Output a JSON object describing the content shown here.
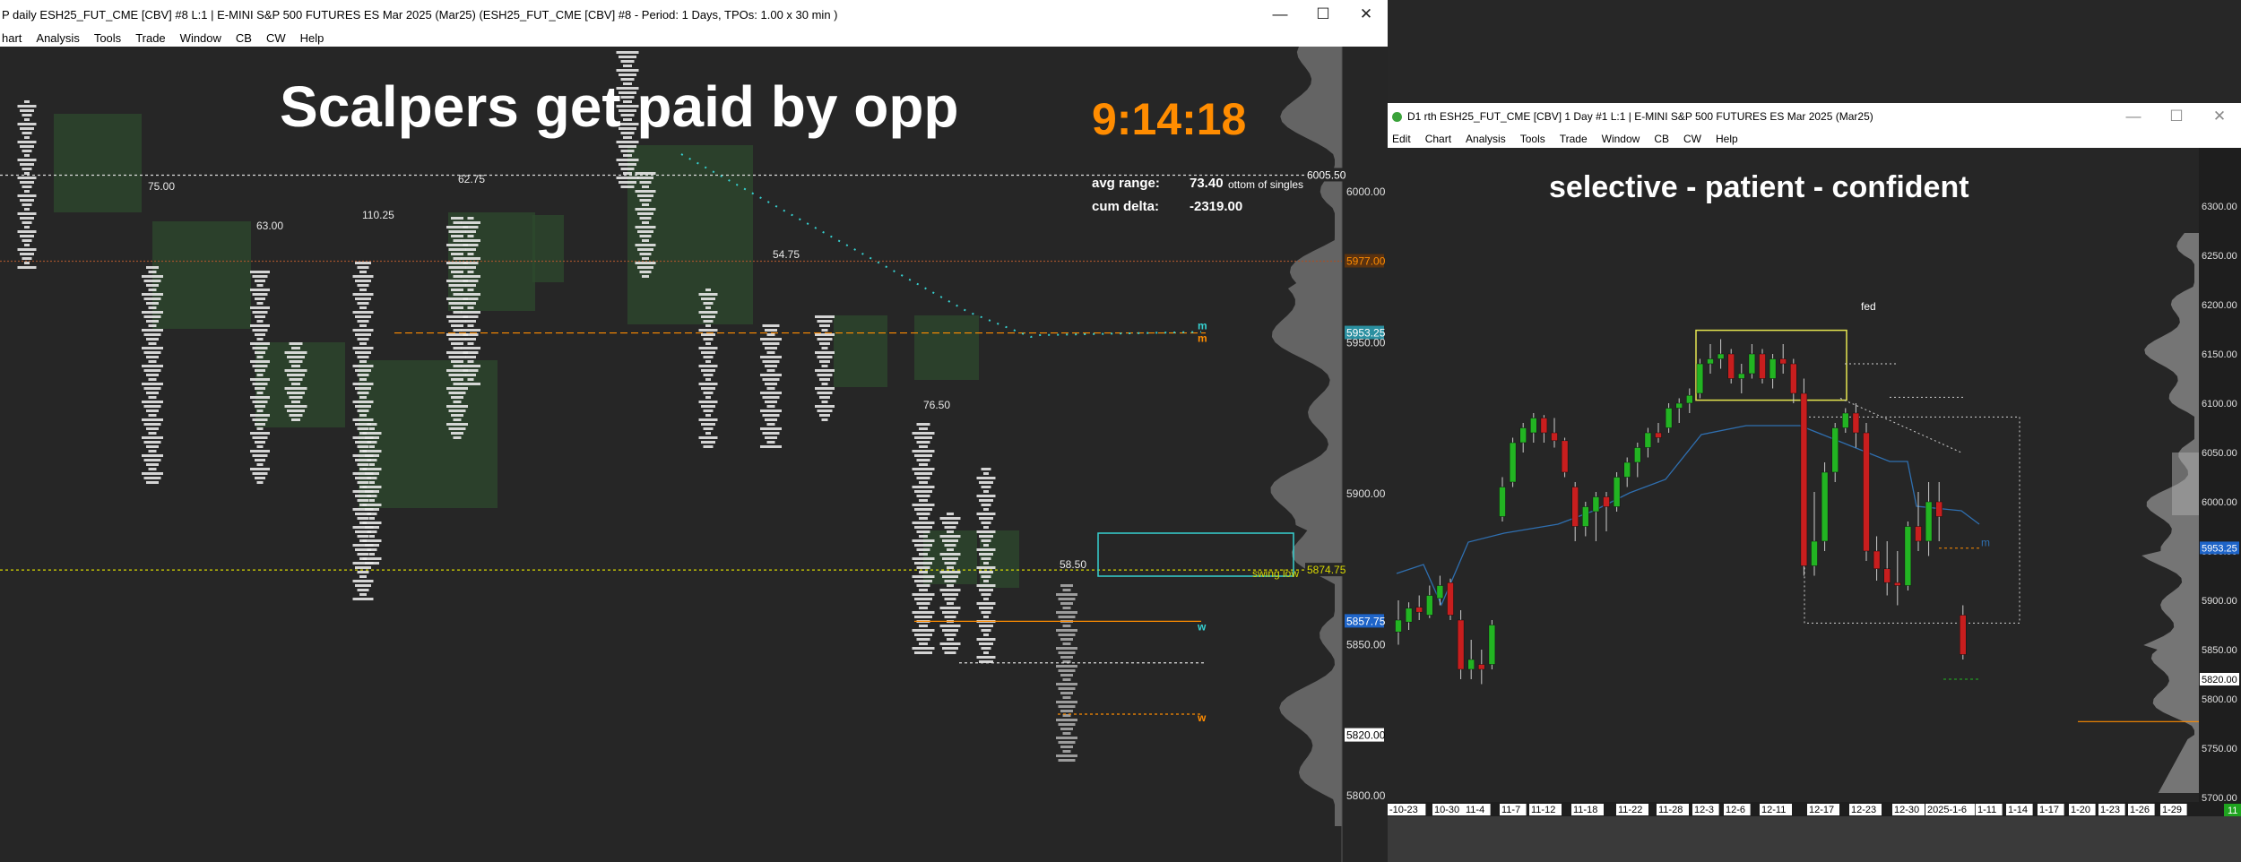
{
  "left_window": {
    "title": "P daily ESH25_FUT_CME [CBV] #8 L:1 | E-MINI S&P 500 FUTURES ES Mar 2025 (Mar25) (ESH25_FUT_CME [CBV] #8 - Period: 1 Days, TPOs: 1.00 x 30 min )",
    "menu": [
      "hart",
      "Analysis",
      "Tools",
      "Trade",
      "Window",
      "CB",
      "CW",
      "Help"
    ],
    "headline": "Scalpers get paid by opp",
    "clock": "9:14:18",
    "stats": {
      "avg_range_label": "avg range:",
      "avg_range_value": "73.40",
      "cum_delta_label": "cum delta:",
      "cum_delta_value": "-2319.00",
      "bottom_singles": "ottom of singles"
    },
    "range_labels": [
      "75.00",
      "63.00",
      "110.25",
      "62.75",
      "54.75",
      "76.50",
      "58.50"
    ],
    "swing_low_label": "swing low",
    "line_marks": [
      "m",
      "m",
      "w",
      "w"
    ],
    "price_axis": [
      {
        "text": "6005.50",
        "price": 6005.5,
        "style": "tag"
      },
      {
        "text": "6000.00",
        "price": 6000,
        "style": "tick"
      },
      {
        "text": "5977.00",
        "price": 5977,
        "style": "orange"
      },
      {
        "text": "5953.25",
        "price": 5953.25,
        "style": "cyan"
      },
      {
        "text": "5950.00",
        "price": 5950,
        "style": "tick"
      },
      {
        "text": "5900.00",
        "price": 5900,
        "style": "tick"
      },
      {
        "text": "5874.75",
        "price": 5874.75,
        "style": "tag"
      },
      {
        "text": "5857.75",
        "price": 5857.75,
        "style": "blue"
      },
      {
        "text": "5850.00",
        "price": 5850,
        "style": "tick"
      },
      {
        "text": "5820.00",
        "price": 5820,
        "style": "white"
      },
      {
        "text": "5800.00",
        "price": 5800,
        "style": "tick"
      }
    ]
  },
  "right_window": {
    "title": "D1 rth ESH25_FUT_CME [CBV]  1 Day  #1 L:1 | E-MINI S&P 500 FUTURES ES Mar 2025 (Mar25)",
    "menu": [
      "Edit",
      "Chart",
      "Analysis",
      "Tools",
      "Trade",
      "Window",
      "CB",
      "CW",
      "Help"
    ],
    "headline": "selective  -  patient  -  confident",
    "fed_label": "fed",
    "mark_label": "m",
    "price_ticks": [
      "6300.00",
      "6250.00",
      "6200.00",
      "6150.00",
      "6100.00",
      "6050.00",
      "6000.00",
      "5950.00",
      "5900.00",
      "5850.00",
      "5800.00",
      "5750.00",
      "5700.00"
    ],
    "price_tags": [
      {
        "text": "5953.25",
        "price": 5953.25,
        "color": "#1e64c8"
      },
      {
        "text": "5820.00",
        "price": 5820,
        "color": "#ffffff"
      }
    ],
    "date_ticks": [
      "-10-23",
      "10-30",
      "11-4",
      "11-7",
      "11-12",
      "11-18",
      "11-22",
      "11-28",
      "12-3",
      "12-6",
      "12-11",
      "12-17",
      "12-23",
      "12-30",
      "2025-1-6",
      "1-11",
      "1-14",
      "1-17",
      "1-20",
      "1-23",
      "1-26",
      "1-29"
    ],
    "corner_badge": "11"
  },
  "colors": {
    "up": "#22b422",
    "down": "#c81e1e",
    "orange": "#ff8c00",
    "cyan": "#36d0d0",
    "value_area": "#2e4a2e",
    "profile": "#707070",
    "yellow": "#e6e650"
  },
  "chart_data": [
    {
      "type": "candlestick",
      "name": "",
      "dates": [
        "10-23",
        "10-24",
        "10-25",
        "10-28",
        "10-29",
        "10-30",
        "10-31",
        "11-1",
        "11-4",
        "11-5",
        "11-6",
        "11-7",
        "11-8",
        "11-11",
        "11-12",
        "11-13",
        "11-14",
        "11-15",
        "11-18",
        "11-19",
        "11-20",
        "11-21",
        "11-22",
        "11-25",
        "11-26",
        "11-27",
        "11-29",
        "12-2",
        "12-3",
        "12-4",
        "12-5",
        "12-6",
        "12-9",
        "12-10",
        "12-11",
        "12-12",
        "12-13",
        "12-16",
        "12-17",
        "12-18",
        "12-19",
        "12-20",
        "12-23",
        "12-24",
        "12-26",
        "12-27",
        "12-30",
        "12-31",
        "1-2",
        "1-3",
        "1-6",
        "1-7",
        "1-8",
        "1-10"
      ],
      "ohlc": [
        [
          5868,
          5900,
          5855,
          5880
        ],
        [
          5878,
          5898,
          5870,
          5892
        ],
        [
          5893,
          5905,
          5880,
          5888
        ],
        [
          5885,
          5915,
          5882,
          5905
        ],
        [
          5902,
          5925,
          5895,
          5915
        ],
        [
          5918,
          5922,
          5880,
          5885
        ],
        [
          5880,
          5890,
          5820,
          5830
        ],
        [
          5830,
          5860,
          5820,
          5840
        ],
        [
          5835,
          5850,
          5815,
          5830
        ],
        [
          5835,
          5880,
          5830,
          5875
        ],
        [
          5985,
          6025,
          5980,
          6015
        ],
        [
          6020,
          6065,
          6015,
          6060
        ],
        [
          6060,
          6080,
          6050,
          6075
        ],
        [
          6070,
          6090,
          6060,
          6085
        ],
        [
          6085,
          6088,
          6060,
          6070
        ],
        [
          6070,
          6085,
          6055,
          6062
        ],
        [
          6062,
          6065,
          6025,
          6030
        ],
        [
          6015,
          6020,
          5960,
          5975
        ],
        [
          5975,
          6000,
          5965,
          5995
        ],
        [
          5990,
          6010,
          5960,
          6005
        ],
        [
          6005,
          6010,
          5970,
          5995
        ],
        [
          5995,
          6030,
          5990,
          6025
        ],
        [
          6025,
          6045,
          6015,
          6040
        ],
        [
          6040,
          6060,
          6025,
          6055
        ],
        [
          6055,
          6075,
          6045,
          6070
        ],
        [
          6070,
          6080,
          6060,
          6065
        ],
        [
          6075,
          6100,
          6070,
          6095
        ],
        [
          6095,
          6105,
          6080,
          6100
        ],
        [
          6100,
          6115,
          6090,
          6108
        ],
        [
          6110,
          6145,
          6105,
          6140
        ],
        [
          6140,
          6160,
          6130,
          6145
        ],
        [
          6145,
          6165,
          6135,
          6150
        ],
        [
          6150,
          6155,
          6120,
          6125
        ],
        [
          6125,
          6140,
          6110,
          6130
        ],
        [
          6130,
          6160,
          6125,
          6150
        ],
        [
          6150,
          6155,
          6120,
          6125
        ],
        [
          6125,
          6150,
          6115,
          6145
        ],
        [
          6145,
          6160,
          6130,
          6140
        ],
        [
          6140,
          6145,
          6100,
          6110
        ],
        [
          6110,
          6125,
          5925,
          5935
        ],
        [
          5935,
          6010,
          5925,
          5960
        ],
        [
          5960,
          6040,
          5950,
          6030
        ],
        [
          6030,
          6080,
          6020,
          6075
        ],
        [
          6075,
          6095,
          6070,
          6090
        ],
        [
          6090,
          6100,
          6055,
          6070
        ],
        [
          6070,
          6080,
          5940,
          5950
        ],
        [
          5950,
          5965,
          5920,
          5932
        ],
        [
          5932,
          5960,
          5905,
          5918
        ],
        [
          5918,
          5950,
          5895,
          5915
        ],
        [
          5915,
          5980,
          5910,
          5975
        ],
        [
          5975,
          6010,
          5950,
          5960
        ],
        [
          5960,
          6020,
          5945,
          6000
        ],
        [
          6000,
          6020,
          5960,
          5985
        ],
        [
          5885,
          5895,
          5840,
          5845
        ]
      ],
      "colors": {
        "up": "#22b422",
        "down": "#c81e1e"
      }
    }
  ]
}
